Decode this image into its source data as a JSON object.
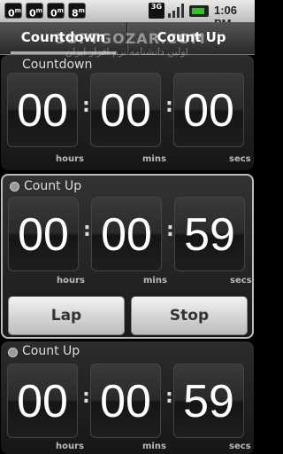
{
  "status_bar": {
    "notifications": [
      {
        "icon": "clock-notification-icon",
        "value": "0",
        "sup": "m"
      },
      {
        "icon": "clock-notification-icon",
        "value": "0",
        "sup": "m"
      },
      {
        "icon": "clock-notification-icon",
        "value": "0",
        "sup": "m"
      },
      {
        "icon": "clock-notification-icon",
        "value": "8",
        "sup": "m"
      }
    ],
    "network": "3G",
    "time": "1:06 PM"
  },
  "tabs": [
    {
      "label": "Countdown",
      "selected": true
    },
    {
      "label": "Count Up",
      "selected": false
    }
  ],
  "watermark": {
    "text": "SOFTGOZAR.COM",
    "subtext": "اولین دانشنامه نرم افزار ایران"
  },
  "timers": [
    {
      "title": "Countdown",
      "hours": "00",
      "mins": "00",
      "secs": "00"
    },
    {
      "title": "Count Up",
      "hours": "00",
      "mins": "00",
      "secs": "59",
      "buttons": {
        "lap": "Lap",
        "stop": "Stop"
      }
    },
    {
      "title": "Count Up",
      "hours": "00",
      "mins": "00",
      "secs": "59"
    }
  ],
  "units": {
    "hours": "hours",
    "mins": "mins",
    "secs": "secs"
  },
  "colors": {
    "battery": "#35c02a",
    "selected_border": "#bdbdbd"
  }
}
